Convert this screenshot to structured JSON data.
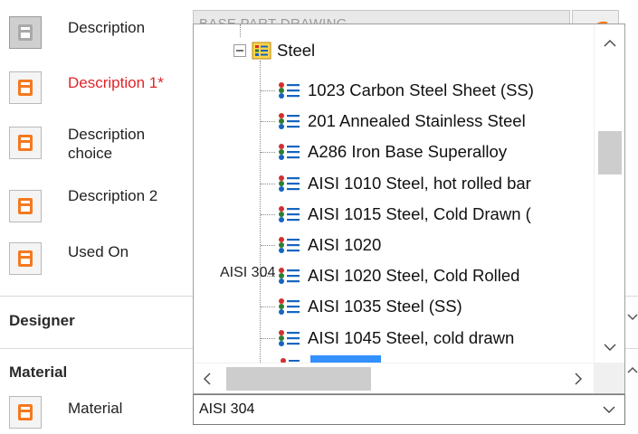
{
  "properties": [
    {
      "label": "Description",
      "required": false,
      "icon": "save-icon-disabled"
    },
    {
      "label": "Description 1*",
      "required": true,
      "icon": "save-icon"
    },
    {
      "label": "Description choice",
      "required": false,
      "icon": "save-icon"
    },
    {
      "label": "Description 2",
      "required": false,
      "icon": "save-icon"
    },
    {
      "label": "Used On",
      "required": false,
      "icon": "save-icon"
    }
  ],
  "description_field": {
    "value": "BASE PART DRAWING"
  },
  "sections": {
    "designer": "Designer",
    "material": "Material"
  },
  "material_row": {
    "label": "Material",
    "value": "AISI 304"
  },
  "tree": {
    "group": "Steel",
    "items": [
      "1023 Carbon Steel Sheet (SS)",
      "201 Annealed Stainless Steel",
      "A286 Iron Base Superalloy",
      "AISI 1010 Steel, hot rolled bar",
      "AISI 1015 Steel, Cold Drawn (",
      "AISI 1020",
      "AISI 1020 Steel, Cold Rolled",
      "AISI 1035 Steel (SS)",
      "AISI 1045 Steel, cold drawn"
    ],
    "selected_partial": "AISI 304"
  },
  "colors": {
    "save_orange": "#f47920",
    "required_red": "#e0242a",
    "selection_blue": "#3390ff"
  }
}
